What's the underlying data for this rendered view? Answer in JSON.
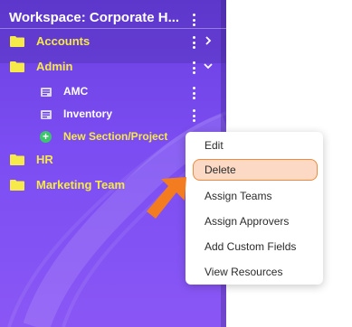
{
  "workspace": {
    "title": "Workspace: Corporate H..."
  },
  "sidebar": {
    "items": [
      {
        "label": "Accounts"
      },
      {
        "label": "Admin"
      },
      {
        "label": "AMC"
      },
      {
        "label": "Inventory"
      },
      {
        "label": "New Section/Project"
      },
      {
        "label": "HR"
      },
      {
        "label": "Marketing Team"
      }
    ]
  },
  "context_menu": {
    "items": [
      {
        "label": "Edit"
      },
      {
        "label": "Delete"
      },
      {
        "label": "Assign Teams"
      },
      {
        "label": "Assign Approvers"
      },
      {
        "label": "Add Custom Fields"
      },
      {
        "label": "View Resources"
      }
    ],
    "highlighted": "Delete"
  },
  "colors": {
    "sidebar_bg": "#7b4df2",
    "folder": "#f6e94a",
    "label": "#f6e94a",
    "highlight_bg": "#fbd9c4",
    "highlight_border": "#f08a3c",
    "arrow": "#f47c20",
    "add_icon": "#3ec46d"
  },
  "icons": [
    "folder-icon",
    "kebab-icon",
    "chevron-right-icon",
    "chevron-down-icon",
    "document-icon",
    "plus-circle-icon",
    "arrow-pointer-icon"
  ]
}
